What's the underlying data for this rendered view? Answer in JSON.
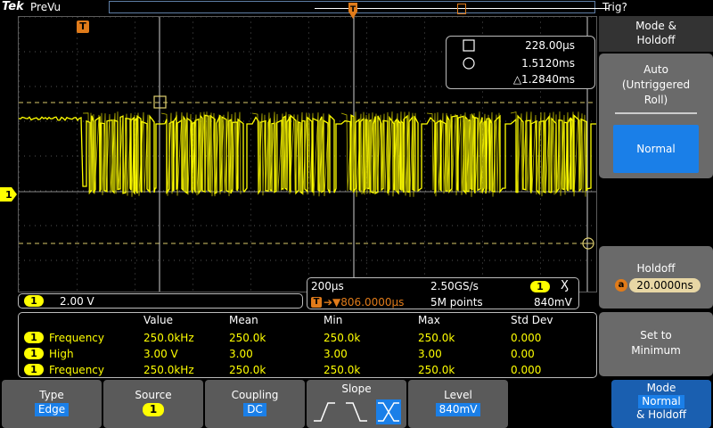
{
  "topbar": {
    "brand": "Tek",
    "mode": "PreVu",
    "trigger_status": "Trig?"
  },
  "colors": {
    "channel1": "#ffff00",
    "trigger": "#e07b1a",
    "selected": "#1a7fe8",
    "menu_bg": "#5a5a5a"
  },
  "icons": {
    "trigger_marker": "T",
    "channel_marker": "1",
    "cursor_a": "square-icon",
    "cursor_b": "circle-icon"
  },
  "cursors": {
    "a_value": "228.00µs",
    "b_value": "1.5120ms",
    "delta_value": "△1.2840ms"
  },
  "channel1": {
    "badge": "1",
    "scale": "2.00 V"
  },
  "timebase": {
    "scale": "200µs",
    "sample_rate": "2.50GS/s",
    "trigger_channel": "1",
    "trigger_edge_symbol": "Ӽ",
    "trigger_position": "➔▼806.0000µs",
    "record_length": "5M points",
    "trigger_level": "840mV"
  },
  "measurements": {
    "headers": [
      "Value",
      "Mean",
      "Min",
      "Max",
      "Std Dev"
    ],
    "rows": [
      {
        "channel": "1",
        "name": "Frequency",
        "value": "250.0kHz",
        "mean": "250.0k",
        "min": "250.0k",
        "max": "250.0k",
        "stddev": "0.000"
      },
      {
        "channel": "1",
        "name": "High",
        "value": "3.00 V",
        "mean": "3.00",
        "min": "3.00",
        "max": "3.00",
        "stddev": "0.00"
      },
      {
        "channel": "1",
        "name": "Frequency",
        "value": "250.0kHz",
        "mean": "250.0k",
        "min": "250.0k",
        "max": "250.0k",
        "stddev": "0.000"
      }
    ]
  },
  "right_menu": {
    "title_line1": "Mode &",
    "title_line2": "Holdoff",
    "auto_line1": "Auto",
    "auto_line2": "(Untriggered",
    "auto_line3": "Roll)",
    "normal": "Normal",
    "holdoff_label": "Holdoff",
    "holdoff_knob": "a",
    "holdoff_value": "20.0000ns",
    "set_min_line1": "Set to",
    "set_min_line2": "Minimum"
  },
  "bottom_menu": {
    "type_label": "Type",
    "type_value": "Edge",
    "source_label": "Source",
    "source_value": "1",
    "coupling_label": "Coupling",
    "coupling_value": "DC",
    "slope_label": "Slope",
    "level_label": "Level",
    "level_value": "840mV",
    "mode_line1": "Mode",
    "mode_line2": "Normal",
    "mode_line3": "& Holdoff"
  }
}
